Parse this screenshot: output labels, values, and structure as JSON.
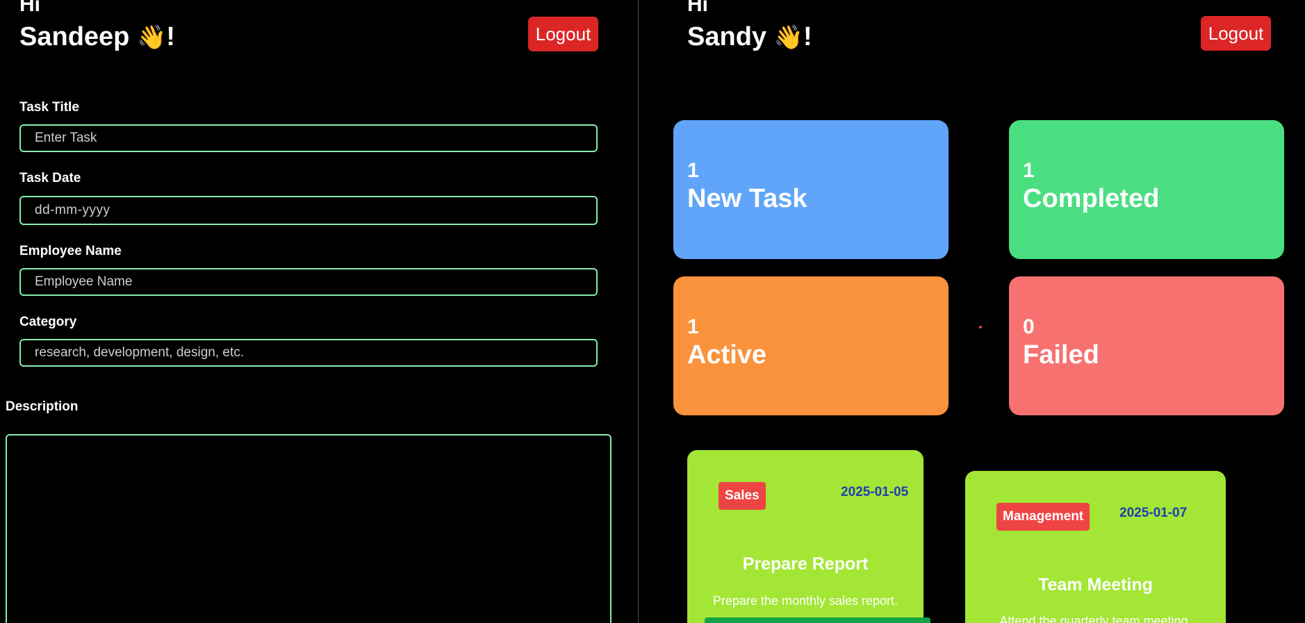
{
  "admin": {
    "greeting": "Hi",
    "name": "Sandeep",
    "wave": "👋",
    "exclaim": "!",
    "logout_label": "Logout",
    "form": {
      "task_title": {
        "label": "Task Title",
        "placeholder": "Enter Task"
      },
      "task_date": {
        "label": "Task Date",
        "placeholder": "dd-mm-yyyy"
      },
      "employee_name": {
        "label": "Employee Name",
        "placeholder": "Employee Name"
      },
      "category": {
        "label": "Category",
        "placeholder": "research, development, design, etc."
      },
      "description": {
        "label": "Description"
      }
    }
  },
  "employee": {
    "greeting": "Hi",
    "name": "Sandy",
    "wave": "👋",
    "exclaim": "!",
    "logout_label": "Logout",
    "stats": [
      {
        "count": "1",
        "label": "New Task",
        "color": "#60a5fa"
      },
      {
        "count": "1",
        "label": "Completed",
        "color": "#4ade80"
      },
      {
        "count": "1",
        "label": "Active",
        "color": "#fb923c"
      },
      {
        "count": "0",
        "label": "Failed",
        "color": "#f87171"
      }
    ],
    "tasks": [
      {
        "category": "Sales",
        "date": "2025-01-05",
        "title": "Prepare Report",
        "description": "Prepare the monthly sales report."
      },
      {
        "category": "Management",
        "date": "2025-01-07",
        "title": "Team Meeting",
        "description": "Attend the quarterly team meeting."
      }
    ]
  },
  "colors": {
    "background": "#000000",
    "logout": "#dc2626",
    "input_border": "#86efac",
    "task_card": "#a3e635",
    "category_badge": "#ef4444",
    "task_date": "#1e40af",
    "accept_button": "#16a34a"
  },
  "icons": {
    "wave": "waving-hand-icon"
  }
}
